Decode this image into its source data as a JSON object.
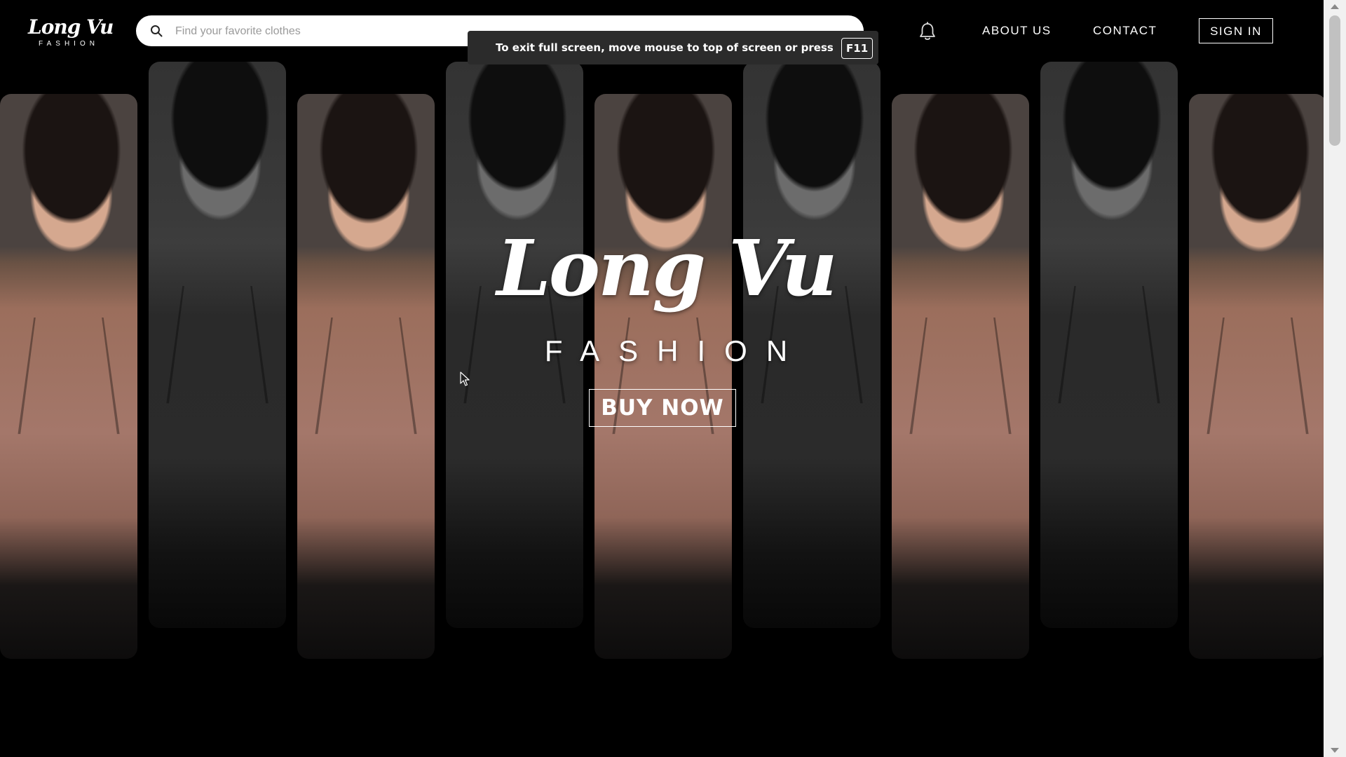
{
  "header": {
    "logo": {
      "script": "Long Vu",
      "sub": "FASHION"
    },
    "search": {
      "placeholder": "Find your favorite clothes",
      "value": ""
    },
    "nav": {
      "about": "ABOUT US",
      "contact": "CONTACT",
      "sign_in": "SIGN IN"
    }
  },
  "fullscreen_notice": {
    "message": "To exit full screen, move mouse to top of screen or press",
    "key": "F11"
  },
  "hero": {
    "title": "Long Vu",
    "subtitle": "FASHION",
    "cta": "BUY NOW"
  },
  "colors": {
    "background": "#000000",
    "text": "#ffffff",
    "sweater": "#a4776a"
  },
  "icons": [
    "search-icon",
    "bell-icon",
    "cursor-icon"
  ]
}
